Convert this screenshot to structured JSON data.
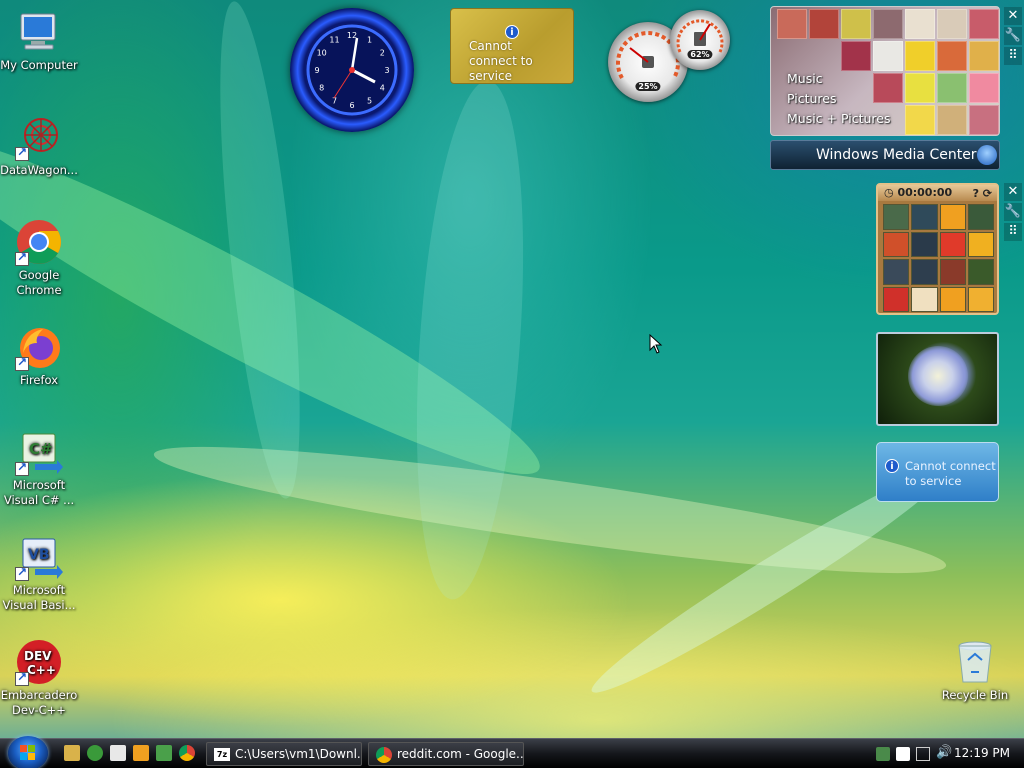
{
  "desktop": {
    "icons": [
      {
        "label": "My Computer"
      },
      {
        "label": "DataWagon..."
      },
      {
        "label": "Google Chrome"
      },
      {
        "label": "Firefox"
      },
      {
        "label": "Microsoft Visual C# ..."
      },
      {
        "label": "Microsoft Visual Basi..."
      },
      {
        "label": "Embarcadero Dev-C++"
      },
      {
        "label": "Recycle Bin"
      }
    ]
  },
  "gadgets": {
    "clock": {
      "numbers": [
        "12",
        "1",
        "2",
        "3",
        "4",
        "5",
        "6",
        "7",
        "8",
        "9",
        "10",
        "11"
      ]
    },
    "weather": {
      "message": "Cannot connect to service"
    },
    "meters": {
      "cpu": "25%",
      "memory": "62%"
    },
    "media_center": {
      "items": [
        "Music",
        "Pictures",
        "Music + Pictures"
      ],
      "brand": "Windows Media Center"
    },
    "puzzle": {
      "timer": "00:00:00"
    },
    "weather_small": {
      "message": "Cannot connect to service"
    }
  },
  "taskbar": {
    "tasks": [
      {
        "label": "C:\\Users\\vm1\\Downl..."
      },
      {
        "label": "reddit.com - Google..."
      }
    ],
    "time": "12:19 PM"
  }
}
